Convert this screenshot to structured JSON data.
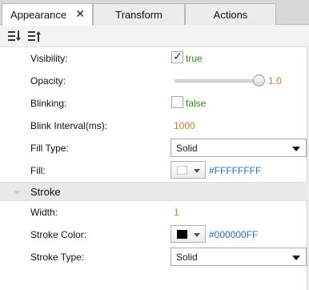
{
  "tabs": [
    {
      "label": "Appearance",
      "closable": true,
      "active": true
    },
    {
      "label": "Transform",
      "active": false
    },
    {
      "label": "Actions",
      "active": false
    }
  ],
  "toolbar": {
    "icons": [
      "sort-descending-icon",
      "sort-ascending-icon"
    ]
  },
  "properties": {
    "visibility": {
      "label": "Visibility:",
      "checked": true,
      "value": "true"
    },
    "opacity": {
      "label": "Opacity:",
      "value": "1.0",
      "level": 1.0
    },
    "blinking": {
      "label": "Blinking:",
      "checked": false,
      "value": "false"
    },
    "blink_interval": {
      "label": "Blink Interval(ms):",
      "value": "1000"
    },
    "fill_type": {
      "label": "Fill Type:",
      "value": "Solid"
    },
    "fill": {
      "label": "Fill:",
      "value": "#FFFFFFFF",
      "swatch": "#ffffff"
    }
  },
  "stroke_section": {
    "title": "Stroke",
    "width": {
      "label": "Width:",
      "value": "1"
    },
    "stroke_color": {
      "label": "Stroke Color:",
      "value": "#000000FF",
      "swatch": "#000000"
    },
    "stroke_type": {
      "label": "Stroke Type:",
      "value": "Solid"
    }
  },
  "colors": {
    "true_false": "#2e8b1e",
    "numeric": "#d07a26",
    "color_hex": "#2a6fb0"
  }
}
